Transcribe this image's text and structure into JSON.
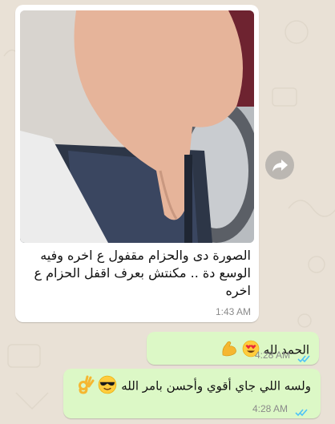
{
  "messages": [
    {
      "type": "image",
      "direction": "incoming",
      "caption": "الصورة دى والحزام مقفول ع اخره وفيه الوسع دة .. مكنتش بعرف اقفل الحزام ع اخره",
      "time": "1:43 AM",
      "image_description_icon": "photo-thumbnail"
    },
    {
      "type": "text",
      "direction": "outgoing",
      "text": "الحمد لله",
      "emojis": [
        "heart-eyes-emoji",
        "flexed-biceps-emoji"
      ],
      "time": "4:28 AM",
      "status": "read"
    },
    {
      "type": "text",
      "direction": "outgoing",
      "text": "ولسه اللي جاي أقوي وأحسن بامر الله",
      "emojis": [
        "sunglasses-emoji",
        "ok-hand-emoji"
      ],
      "time": "4:28 AM",
      "status": "read"
    }
  ],
  "colors": {
    "wallpaper": "#e9e1d6",
    "incoming_bubble": "#ffffff",
    "outgoing_bubble": "#dcf8c6",
    "read_ticks": "#4fc3f7",
    "timestamp": "#8a8a8a"
  }
}
